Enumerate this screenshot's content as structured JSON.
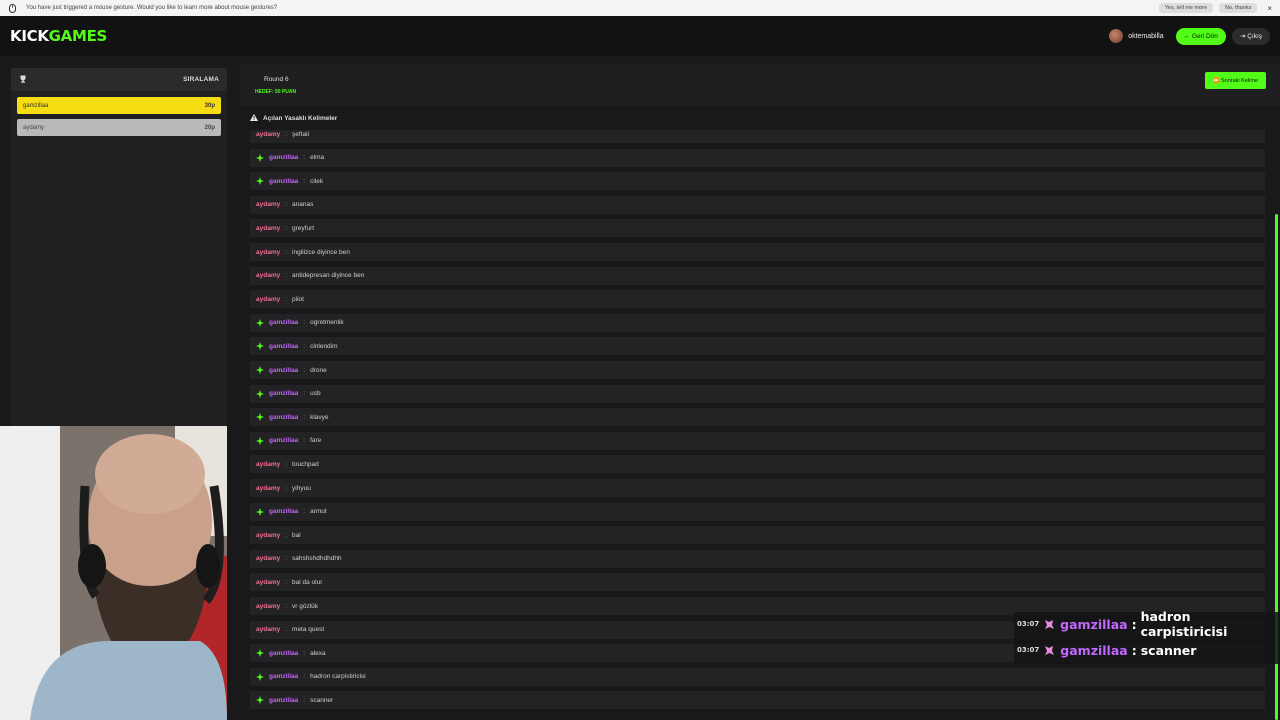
{
  "notification": {
    "message": "You have just triggered a mouse gesture. Would you like to learn more about mouse gestures?",
    "yes_label": "Yes, tell me more",
    "no_label": "No, thanks",
    "close_label": "×"
  },
  "header": {
    "logo_part1": "KICK",
    "logo_part2": "GAMES",
    "username": "oktemabilla",
    "back_label": "← Geri Dön",
    "exit_label": "⇥ Çıkış"
  },
  "sidebar": {
    "title": "SIRALAMA",
    "players": [
      {
        "name": "gamzillaa",
        "points": "30p"
      },
      {
        "name": "aydamy",
        "points": "20p"
      }
    ]
  },
  "round": {
    "label": "Round 6",
    "target": "HEDEF: 50 PUAN",
    "next_label": "⏩ Sonraki Kelime"
  },
  "banned": {
    "title": "Açılan Yasaklı Kelimeler"
  },
  "messages": [
    {
      "user": "aydamy",
      "word": "şeftali",
      "correct": false
    },
    {
      "user": "gamzillaa",
      "word": "elma",
      "correct": true
    },
    {
      "user": "gamzillaa",
      "word": "cilek",
      "correct": true
    },
    {
      "user": "aydamy",
      "word": "ananas",
      "correct": false
    },
    {
      "user": "aydamy",
      "word": "greyfurt",
      "correct": false
    },
    {
      "user": "aydamy",
      "word": "ingilizce diyince ben",
      "correct": false
    },
    {
      "user": "aydamy",
      "word": "antidepresan diyince ben",
      "correct": false
    },
    {
      "user": "aydamy",
      "word": "pilot",
      "correct": false
    },
    {
      "user": "gamzillaa",
      "word": "ogretmenlik",
      "correct": true
    },
    {
      "user": "gamzillaa",
      "word": "cinlendim",
      "correct": true
    },
    {
      "user": "gamzillaa",
      "word": "drone",
      "correct": true
    },
    {
      "user": "gamzillaa",
      "word": "usb",
      "correct": true
    },
    {
      "user": "gamzillaa",
      "word": "klavye",
      "correct": true
    },
    {
      "user": "gamzillaa",
      "word": "fare",
      "correct": true
    },
    {
      "user": "aydamy",
      "word": "touchpad",
      "correct": false
    },
    {
      "user": "aydamy",
      "word": "yihyuu",
      "correct": false
    },
    {
      "user": "gamzillaa",
      "word": "armut",
      "correct": true
    },
    {
      "user": "aydamy",
      "word": "bal",
      "correct": false
    },
    {
      "user": "aydamy",
      "word": "sahshshdhdhdhh",
      "correct": false
    },
    {
      "user": "aydamy",
      "word": "bal da olur",
      "correct": false
    },
    {
      "user": "aydamy",
      "word": "vr gözlük",
      "correct": false
    },
    {
      "user": "aydamy",
      "word": "meta quest",
      "correct": false
    },
    {
      "user": "gamzillaa",
      "word": "alexa",
      "correct": true
    },
    {
      "user": "gamzillaa",
      "word": "hadron carpistiricisi",
      "correct": true
    },
    {
      "user": "gamzillaa",
      "word": "scanner",
      "correct": true
    }
  ],
  "message_separator": ":",
  "chat_overlay": [
    {
      "time": "03:07",
      "user": "gamzillaa",
      "text": "hadron carpistiricisi"
    },
    {
      "time": "03:07",
      "user": "gamzillaa",
      "text": "scanner"
    }
  ],
  "colors": {
    "accent": "#53fc18",
    "leader": "#f5dc13",
    "user_correct": "#c265f5",
    "user_other": "#f56b8d"
  }
}
